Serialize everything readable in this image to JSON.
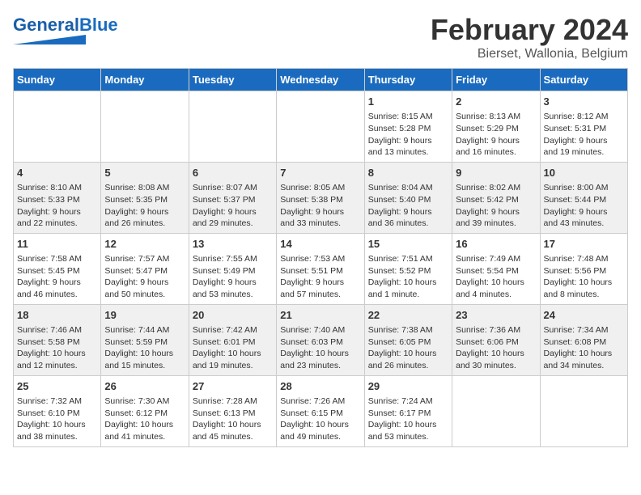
{
  "header": {
    "logo_text_general": "General",
    "logo_text_blue": "Blue",
    "main_title": "February 2024",
    "subtitle": "Bierset, Wallonia, Belgium"
  },
  "days_of_week": [
    "Sunday",
    "Monday",
    "Tuesday",
    "Wednesday",
    "Thursday",
    "Friday",
    "Saturday"
  ],
  "weeks": [
    [
      {
        "day": "",
        "info": ""
      },
      {
        "day": "",
        "info": ""
      },
      {
        "day": "",
        "info": ""
      },
      {
        "day": "",
        "info": ""
      },
      {
        "day": "1",
        "info": "Sunrise: 8:15 AM\nSunset: 5:28 PM\nDaylight: 9 hours\nand 13 minutes."
      },
      {
        "day": "2",
        "info": "Sunrise: 8:13 AM\nSunset: 5:29 PM\nDaylight: 9 hours\nand 16 minutes."
      },
      {
        "day": "3",
        "info": "Sunrise: 8:12 AM\nSunset: 5:31 PM\nDaylight: 9 hours\nand 19 minutes."
      }
    ],
    [
      {
        "day": "4",
        "info": "Sunrise: 8:10 AM\nSunset: 5:33 PM\nDaylight: 9 hours\nand 22 minutes."
      },
      {
        "day": "5",
        "info": "Sunrise: 8:08 AM\nSunset: 5:35 PM\nDaylight: 9 hours\nand 26 minutes."
      },
      {
        "day": "6",
        "info": "Sunrise: 8:07 AM\nSunset: 5:37 PM\nDaylight: 9 hours\nand 29 minutes."
      },
      {
        "day": "7",
        "info": "Sunrise: 8:05 AM\nSunset: 5:38 PM\nDaylight: 9 hours\nand 33 minutes."
      },
      {
        "day": "8",
        "info": "Sunrise: 8:04 AM\nSunset: 5:40 PM\nDaylight: 9 hours\nand 36 minutes."
      },
      {
        "day": "9",
        "info": "Sunrise: 8:02 AM\nSunset: 5:42 PM\nDaylight: 9 hours\nand 39 minutes."
      },
      {
        "day": "10",
        "info": "Sunrise: 8:00 AM\nSunset: 5:44 PM\nDaylight: 9 hours\nand 43 minutes."
      }
    ],
    [
      {
        "day": "11",
        "info": "Sunrise: 7:58 AM\nSunset: 5:45 PM\nDaylight: 9 hours\nand 46 minutes."
      },
      {
        "day": "12",
        "info": "Sunrise: 7:57 AM\nSunset: 5:47 PM\nDaylight: 9 hours\nand 50 minutes."
      },
      {
        "day": "13",
        "info": "Sunrise: 7:55 AM\nSunset: 5:49 PM\nDaylight: 9 hours\nand 53 minutes."
      },
      {
        "day": "14",
        "info": "Sunrise: 7:53 AM\nSunset: 5:51 PM\nDaylight: 9 hours\nand 57 minutes."
      },
      {
        "day": "15",
        "info": "Sunrise: 7:51 AM\nSunset: 5:52 PM\nDaylight: 10 hours\nand 1 minute."
      },
      {
        "day": "16",
        "info": "Sunrise: 7:49 AM\nSunset: 5:54 PM\nDaylight: 10 hours\nand 4 minutes."
      },
      {
        "day": "17",
        "info": "Sunrise: 7:48 AM\nSunset: 5:56 PM\nDaylight: 10 hours\nand 8 minutes."
      }
    ],
    [
      {
        "day": "18",
        "info": "Sunrise: 7:46 AM\nSunset: 5:58 PM\nDaylight: 10 hours\nand 12 minutes."
      },
      {
        "day": "19",
        "info": "Sunrise: 7:44 AM\nSunset: 5:59 PM\nDaylight: 10 hours\nand 15 minutes."
      },
      {
        "day": "20",
        "info": "Sunrise: 7:42 AM\nSunset: 6:01 PM\nDaylight: 10 hours\nand 19 minutes."
      },
      {
        "day": "21",
        "info": "Sunrise: 7:40 AM\nSunset: 6:03 PM\nDaylight: 10 hours\nand 23 minutes."
      },
      {
        "day": "22",
        "info": "Sunrise: 7:38 AM\nSunset: 6:05 PM\nDaylight: 10 hours\nand 26 minutes."
      },
      {
        "day": "23",
        "info": "Sunrise: 7:36 AM\nSunset: 6:06 PM\nDaylight: 10 hours\nand 30 minutes."
      },
      {
        "day": "24",
        "info": "Sunrise: 7:34 AM\nSunset: 6:08 PM\nDaylight: 10 hours\nand 34 minutes."
      }
    ],
    [
      {
        "day": "25",
        "info": "Sunrise: 7:32 AM\nSunset: 6:10 PM\nDaylight: 10 hours\nand 38 minutes."
      },
      {
        "day": "26",
        "info": "Sunrise: 7:30 AM\nSunset: 6:12 PM\nDaylight: 10 hours\nand 41 minutes."
      },
      {
        "day": "27",
        "info": "Sunrise: 7:28 AM\nSunset: 6:13 PM\nDaylight: 10 hours\nand 45 minutes."
      },
      {
        "day": "28",
        "info": "Sunrise: 7:26 AM\nSunset: 6:15 PM\nDaylight: 10 hours\nand 49 minutes."
      },
      {
        "day": "29",
        "info": "Sunrise: 7:24 AM\nSunset: 6:17 PM\nDaylight: 10 hours\nand 53 minutes."
      },
      {
        "day": "",
        "info": ""
      },
      {
        "day": "",
        "info": ""
      }
    ]
  ]
}
